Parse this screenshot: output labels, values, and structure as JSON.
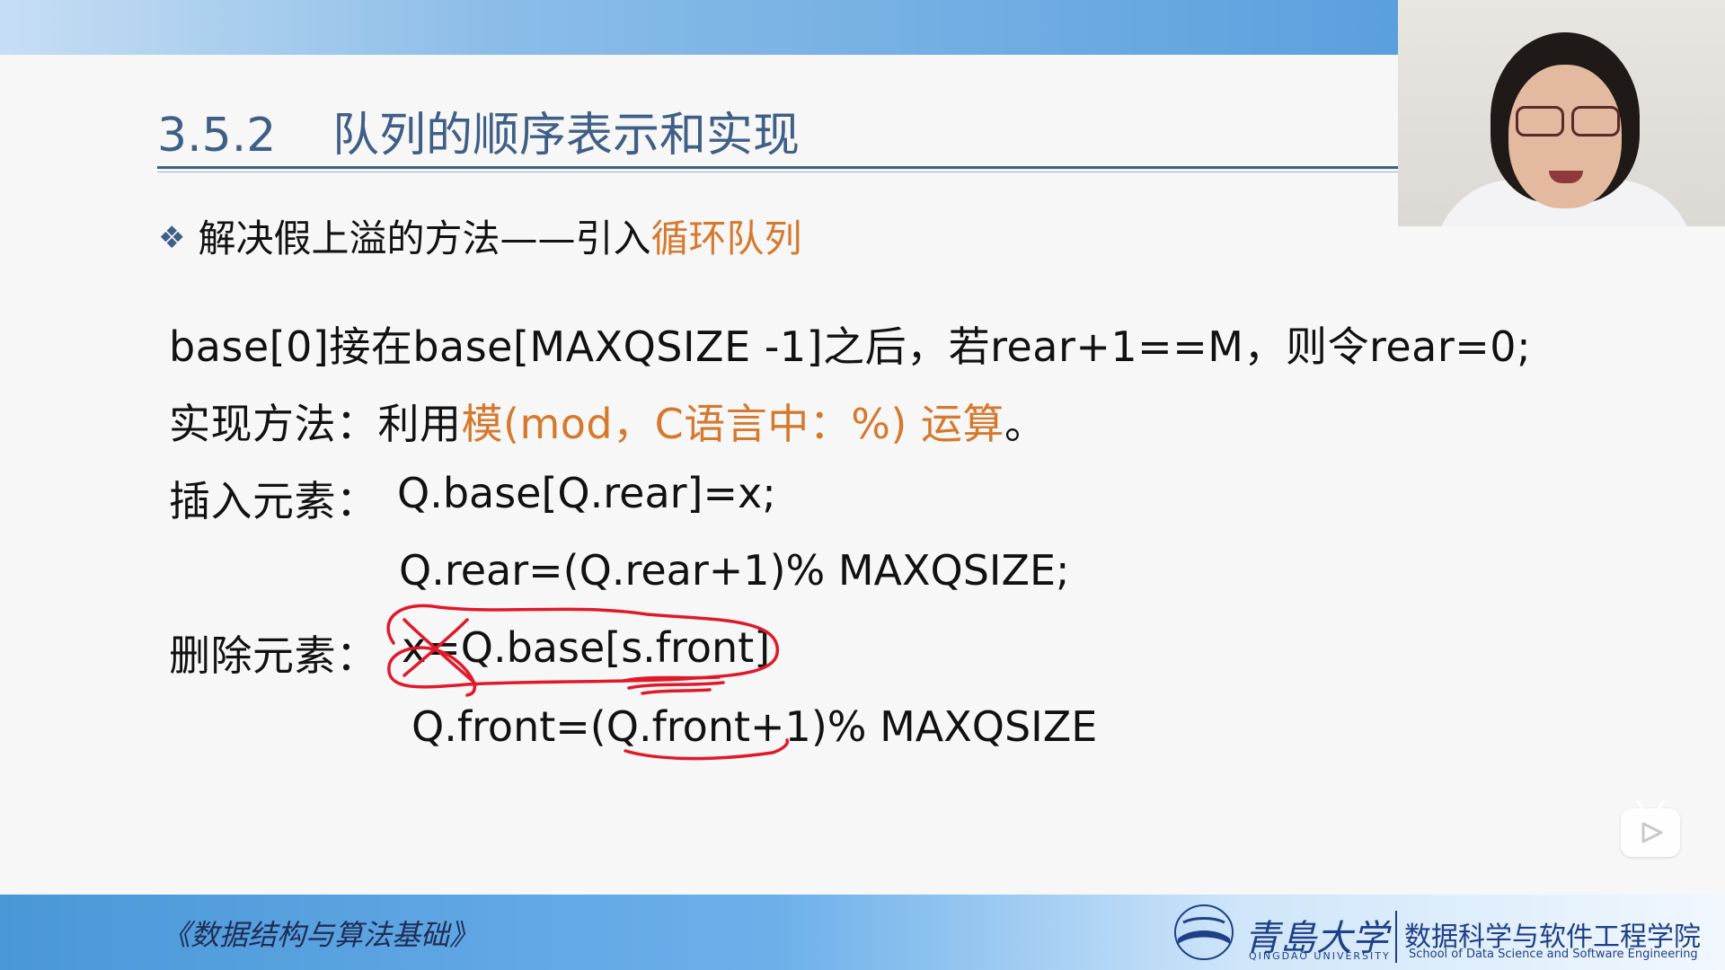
{
  "slide": {
    "section_number": "3.5.2",
    "section_title": "队列的顺序表示和实现",
    "bullet": {
      "prefix": "解决假上溢的方法——引入",
      "highlight": "循环队列"
    },
    "line1": "base[0]接在base[MAXQSIZE -1]之后，若rear+1==M，则令rear=0;",
    "line2": {
      "prefix": "实现方法：利用",
      "highlight": "模(mod，C语言中：%) 运算",
      "suffix": "。"
    },
    "insert": {
      "label": "插入元素：",
      "code1": "Q.base[Q.rear]=x;",
      "code2": "Q.rear=(Q.rear+1)% MAXQSIZE;"
    },
    "delete": {
      "label": "删除元素：",
      "code1": "x=Q.base[s.front]",
      "code2": "Q.front=(Q.front+1)% MAXQSIZE"
    }
  },
  "footer": {
    "book": "《数据结构与算法基础》",
    "university_cn": "青島大学",
    "university_en": "QINGDAO UNIVERSITY",
    "school_cn": "数据科学与软件工程学院",
    "school_en": "School of Data Science and Software Engineering"
  },
  "colors": {
    "title": "#3f5f86",
    "highlight": "#d5792d",
    "annotation": "#e0192a",
    "footer_text": "#1f3f88"
  },
  "icons": {
    "bullet": "diamond-bullet-icon",
    "play": "play-icon",
    "logo": "university-logo-icon"
  }
}
